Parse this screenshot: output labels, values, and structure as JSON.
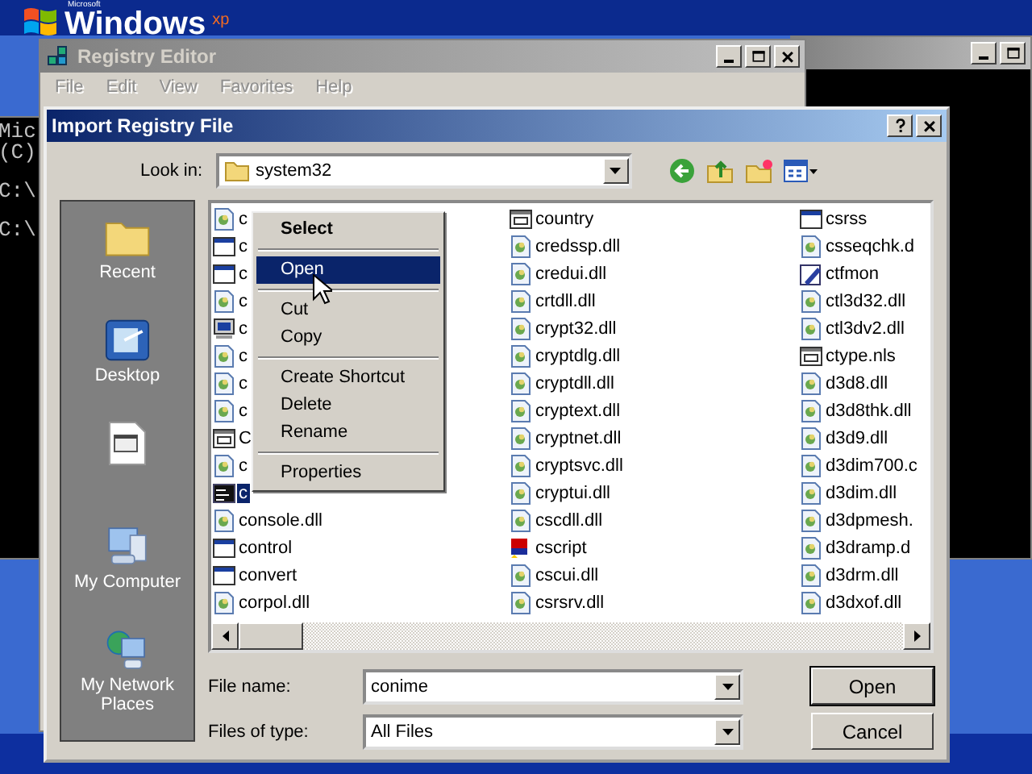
{
  "desktop_logo": {
    "maker": "Microsoft",
    "name": "Windows",
    "edition": "xp"
  },
  "console_window": {
    "lines": [
      "Mic",
      "(C)",
      "C:\\",
      "C:\\"
    ]
  },
  "registry_editor": {
    "title": "Registry Editor",
    "active": false,
    "menu": [
      "File",
      "Edit",
      "View",
      "Favorites",
      "Help"
    ]
  },
  "dialog": {
    "title": "Import Registry File",
    "active": true,
    "look_in": {
      "label": "Look in:",
      "value": "system32"
    },
    "places": [
      {
        "kind": "recent",
        "label": "Recent"
      },
      {
        "kind": "desktop",
        "label": "Desktop"
      },
      {
        "kind": "documents"
      },
      {
        "kind": "computer",
        "label": "My Computer"
      },
      {
        "kind": "network",
        "label": "My Network Places"
      }
    ],
    "files": [
      {
        "name": "c",
        "kind": "dll",
        "selected": false
      },
      {
        "name": "c",
        "kind": "app",
        "selected": false
      },
      {
        "name": "c",
        "kind": "app",
        "selected": false
      },
      {
        "name": "c",
        "kind": "dll",
        "selected": false
      },
      {
        "name": "c",
        "kind": "monitor",
        "selected": false
      },
      {
        "name": "c",
        "kind": "dll",
        "selected": false
      },
      {
        "name": "c",
        "kind": "dll",
        "selected": false
      },
      {
        "name": "c",
        "kind": "dll",
        "selected": false
      },
      {
        "name": "C",
        "kind": "nls",
        "selected": false
      },
      {
        "name": "c",
        "kind": "dll",
        "selected": false
      },
      {
        "name": "c",
        "kind": "console",
        "selected": true
      },
      {
        "name": "console.dll",
        "kind": "dll",
        "selected": false
      },
      {
        "name": "control",
        "kind": "app",
        "selected": false
      },
      {
        "name": "convert",
        "kind": "app",
        "selected": false
      },
      {
        "name": "corpol.dll",
        "kind": "dll",
        "selected": false
      },
      {
        "name": "country",
        "kind": "nls",
        "selected": false
      },
      {
        "name": "credssp.dll",
        "kind": "dll",
        "selected": false
      },
      {
        "name": "credui.dll",
        "kind": "dll",
        "selected": false
      },
      {
        "name": "crtdll.dll",
        "kind": "dll",
        "selected": false
      },
      {
        "name": "crypt32.dll",
        "kind": "dll",
        "selected": false
      },
      {
        "name": "cryptdlg.dll",
        "kind": "dll",
        "selected": false
      },
      {
        "name": "cryptdll.dll",
        "kind": "dll",
        "selected": false
      },
      {
        "name": "cryptext.dll",
        "kind": "dll",
        "selected": false
      },
      {
        "name": "cryptnet.dll",
        "kind": "dll",
        "selected": false
      },
      {
        "name": "cryptsvc.dll",
        "kind": "dll",
        "selected": false
      },
      {
        "name": "cryptui.dll",
        "kind": "dll",
        "selected": false
      },
      {
        "name": "cscdll.dll",
        "kind": "dll",
        "selected": false
      },
      {
        "name": "cscript",
        "kind": "script",
        "selected": false
      },
      {
        "name": "cscui.dll",
        "kind": "dll",
        "selected": false
      },
      {
        "name": "csrsrv.dll",
        "kind": "dll",
        "selected": false
      },
      {
        "name": "csrss",
        "kind": "app",
        "selected": false
      },
      {
        "name": "csseqchk.d",
        "kind": "dll",
        "selected": false
      },
      {
        "name": "ctfmon",
        "kind": "edit",
        "selected": false
      },
      {
        "name": "ctl3d32.dll",
        "kind": "dll",
        "selected": false
      },
      {
        "name": "ctl3dv2.dll",
        "kind": "dll",
        "selected": false
      },
      {
        "name": "ctype.nls",
        "kind": "nls",
        "selected": false
      },
      {
        "name": "d3d8.dll",
        "kind": "dll",
        "selected": false
      },
      {
        "name": "d3d8thk.dll",
        "kind": "dll",
        "selected": false
      },
      {
        "name": "d3d9.dll",
        "kind": "dll",
        "selected": false
      },
      {
        "name": "d3dim700.c",
        "kind": "dll",
        "selected": false
      },
      {
        "name": "d3dim.dll",
        "kind": "dll",
        "selected": false
      },
      {
        "name": "d3dpmesh.",
        "kind": "dll",
        "selected": false
      },
      {
        "name": "d3dramp.d",
        "kind": "dll",
        "selected": false
      },
      {
        "name": "d3drm.dll",
        "kind": "dll",
        "selected": false
      },
      {
        "name": "d3dxof.dll",
        "kind": "dll",
        "selected": false
      }
    ],
    "file_name": {
      "label": "File name:",
      "value": "conime"
    },
    "file_type": {
      "label": "Files of type:",
      "value": "All Files"
    },
    "buttons": [
      {
        "label": "Open",
        "default": true
      },
      {
        "label": "Cancel",
        "default": false
      }
    ]
  },
  "context_menu": {
    "items": [
      {
        "kind": "item",
        "label": "Select",
        "bold": true,
        "selected": false
      },
      {
        "kind": "separator"
      },
      {
        "kind": "item",
        "label": "Open",
        "bold": false,
        "selected": true
      },
      {
        "kind": "separator"
      },
      {
        "kind": "item",
        "label": "Cut",
        "bold": false,
        "selected": false
      },
      {
        "kind": "item",
        "label": "Copy",
        "bold": false,
        "selected": false
      },
      {
        "kind": "separator"
      },
      {
        "kind": "item",
        "label": "Create Shortcut",
        "bold": false,
        "selected": false
      },
      {
        "kind": "item",
        "label": "Delete",
        "bold": false,
        "selected": false
      },
      {
        "kind": "item",
        "label": "Rename",
        "bold": false,
        "selected": false
      },
      {
        "kind": "separator"
      },
      {
        "kind": "item",
        "label": "Properties",
        "bold": false,
        "selected": false
      }
    ]
  }
}
